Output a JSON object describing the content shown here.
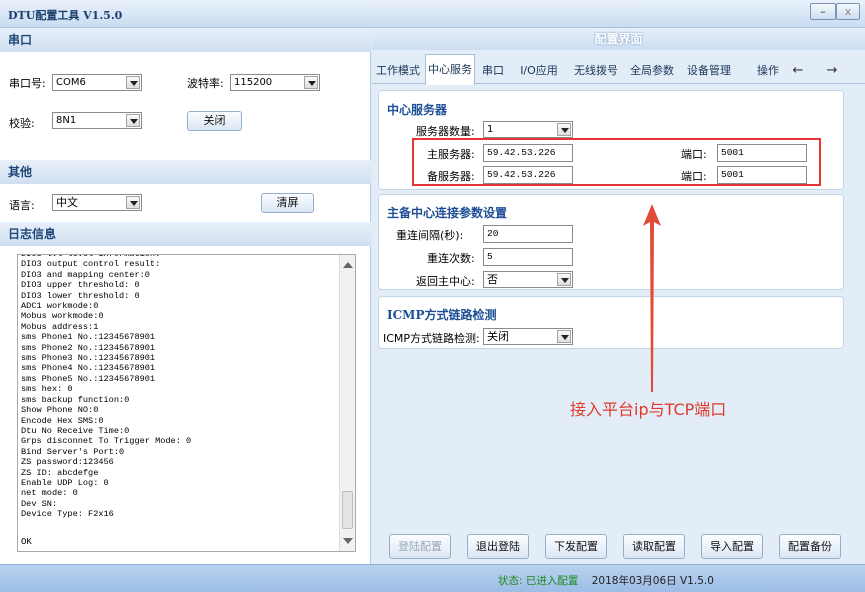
{
  "window": {
    "title": "DTU配置工具 V1.5.0",
    "min_label": "–",
    "close_label": "x"
  },
  "serial": {
    "header": "串口",
    "port_label": "串口号:",
    "port_value": "COM6",
    "baud_label": "波特率:",
    "baud_value": "115200",
    "check_label": "校验:",
    "check_value": "8N1",
    "close_button": "关闭"
  },
  "other": {
    "header": "其他",
    "lang_label": "语言:",
    "lang_value": "中文",
    "clear_button": "清屏"
  },
  "log": {
    "header": "日志信息",
    "text": "DIO3 lvl level information:\nDIO3 output control result:\nDIO3 and mapping center:0\nDIO3 upper threshold: 0\nDIO3 lower threshold: 0\nADC1 workmode:0\nMobus workmode:0\nMobus address:1\nsms Phone1 No.:12345678901\nsms Phone2 No.:12345678901\nsms Phone3 No.:12345678901\nsms Phone4 No.:12345678901\nsms Phone5 No.:12345678901\nsms hex: 0\nsms backup function:0\nShow Phone NO:0\nEncode Hex SMS:0\nDtu No Receive Time:0\nGrps disconnet To Trigger Mode: 0\nBind Server's Port:0\nZS password:123456\nZS ID: abcdefge\nEnable UDP Log: 0\nnet mode: 0\nDev SN:\nDevice Type: F2x16",
    "last_line": "OK"
  },
  "config": {
    "header": "配置界面",
    "tabs": [
      "工作模式",
      "中心服务",
      "串口",
      "I/O应用",
      "无线拨号",
      "全局参数",
      "设备管理",
      "操作"
    ],
    "nav_prev": "←",
    "nav_next": "→",
    "center": {
      "title": "中心服务器",
      "count_label": "服务器数量:",
      "count_value": "1",
      "main_label": "主服务器:",
      "main_value": "59.42.53.226",
      "main_port_label": "端口:",
      "main_port_value": "5001",
      "backup_label": "备服务器:",
      "backup_value": "59.42.53.226",
      "backup_port_label": "端口:",
      "backup_port_value": "5001"
    },
    "reconnect": {
      "title": "主备中心连接参数设置",
      "interval_label": "重连间隔(秒):",
      "interval_value": "20",
      "times_label": "重连次数:",
      "times_value": "5",
      "return_label": "返回主中心:",
      "return_value": "否"
    },
    "icmp": {
      "title": "ICMP方式链路检测",
      "label": "ICMP方式链路检测:",
      "value": "关闭"
    },
    "annotation": "接入平台ip与TCP端口",
    "buttons": [
      "登陆配置",
      "退出登陆",
      "下发配置",
      "读取配置",
      "导入配置",
      "配置备份"
    ]
  },
  "status": {
    "state": "状态: 已进入配置",
    "info": "2018年03月06日 V1.5.0"
  },
  "colors": {
    "annotation": "#e03a2d",
    "accent": "#1e4f96",
    "status_ok": "#1c8a1c"
  }
}
